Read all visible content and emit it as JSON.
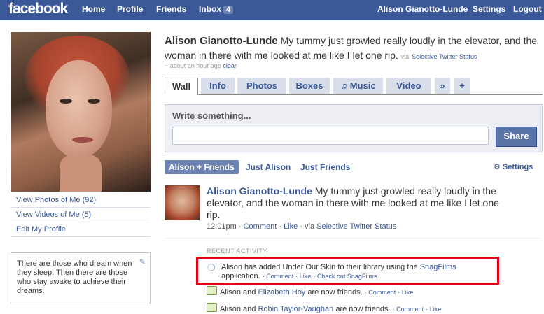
{
  "topbar": {
    "logo": "facebook",
    "nav_left": [
      "Home",
      "Profile",
      "Friends",
      "Inbox"
    ],
    "inbox_count": "4",
    "user_name": "Alison Gianotto-Lunde",
    "settings": "Settings",
    "logout": "Logout"
  },
  "left": {
    "links": [
      "View Photos of Me (92)",
      "View Videos of Me (5)",
      "Edit My Profile"
    ],
    "bio": "There are those who dream when they sleep. Then there are those who stay awake to achieve their dreams."
  },
  "header": {
    "name": "Alison Gianotto-Lunde",
    "status": "My tummy just growled really loudly in the elevator, and the woman in there with me looked at me like I let one rip.",
    "via_prefix": "via",
    "via_app": "Selective Twitter Status",
    "time": "~ about an hour ago",
    "clear": "clear"
  },
  "tabs": [
    "Wall",
    "Info",
    "Photos",
    "Boxes",
    "♫ Music",
    "Video",
    "»",
    "+"
  ],
  "composer": {
    "label": "Write something...",
    "input_value": "",
    "share": "Share"
  },
  "filters": {
    "selected": "Alison + Friends",
    "just_alison": "Just Alison",
    "just_friends": "Just Friends",
    "settings": "⚙ Settings"
  },
  "story": {
    "name": "Alison Gianotto-Lunde",
    "text": "My tummy just growled really loudly in the elevator, and the woman in there with me looked at me like I let one rip.",
    "time": "12:01pm",
    "comment": "Comment",
    "like": "Like",
    "via_prefix": "via",
    "via_app": "Selective Twitter Status"
  },
  "recent": {
    "heading": "RECENT ACTIVITY",
    "item1": {
      "prefix": "Alison has added Under Our Skin to their library using the",
      "app": "SnagFilms",
      "suffix": "application.",
      "comment": "Comment",
      "like": "Like",
      "extra": "Check out SnagFilms"
    },
    "item2": {
      "prefix": "Alison and",
      "friend": "Elizabeth Hoy",
      "suffix": "are now friends.",
      "comment": "Comment",
      "like": "Like"
    },
    "item3": {
      "prefix": "Alison and",
      "friend": "Robin Taylor-Vaughan",
      "suffix": "are now friends.",
      "comment": "Comment",
      "like": "Like"
    }
  },
  "colors": {
    "brand": "#3b5998",
    "highlight": "#e50018"
  }
}
